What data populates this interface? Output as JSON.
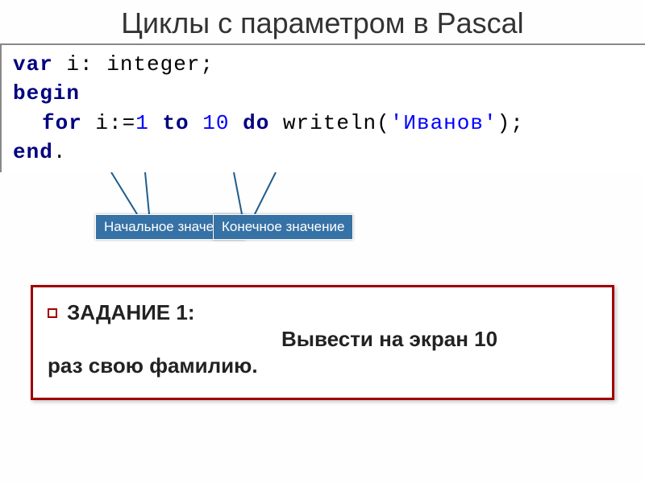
{
  "title": "Циклы с параметром в Pascal",
  "code": {
    "line1_kw": "var",
    "line1_rest": " i: integer;",
    "line2_kw": "begin",
    "line3_for": "for",
    "line3_assign": " i:=",
    "line3_start": "1",
    "line3_to": "to",
    "line3_end": "10",
    "line3_do": "do",
    "line3_write": " writeln(",
    "line3_str": "'Иванов'",
    "line3_close": ");",
    "line4_kw": "end",
    "line4_dot": "."
  },
  "callouts": {
    "start": "Начальное значение",
    "end": "Конечное значение"
  },
  "task": {
    "label": "ЗАДАНИЕ 1:",
    "text_part1": "Вывести на экран 10",
    "text_part2": "раз свою фамилию."
  }
}
